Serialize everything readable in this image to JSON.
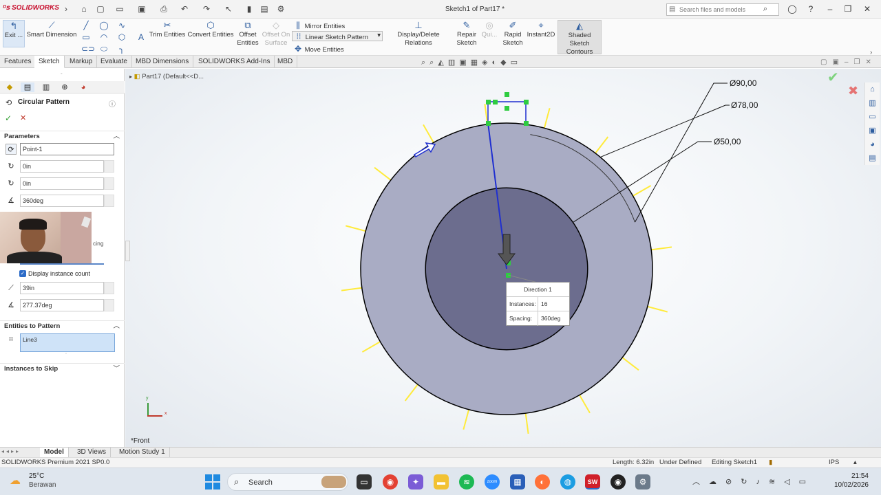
{
  "app": {
    "logo_text": "SOLIDWORKS",
    "doc_title": "Sketch1 of Part17 *",
    "search_placeholder": "Search files and models"
  },
  "ribbon": {
    "exit": "Exit ...",
    "smart_dimension": "Smart Dimension",
    "trim_entities": "Trim Entities",
    "convert_entities": "Convert Entities",
    "offset_entities_l1": "Offset",
    "offset_entities_l2": "Entities",
    "offset_surface_l1": "Offset On",
    "offset_surface_l2": "Surface",
    "mirror_entities": "Mirror Entities",
    "linear_sketch_pattern": "Linear Sketch Pattern",
    "move_entities": "Move Entities",
    "display_delete_relations": "Display/Delete Relations",
    "repair_sketch_l1": "Repair",
    "repair_sketch_l2": "Sketch",
    "quick_snaps": "Qui...",
    "rapid_sketch_l1": "Rapid",
    "rapid_sketch_l2": "Sketch",
    "instant2d": "Instant2D",
    "shaded_contours_l1": "Shaded Sketch",
    "shaded_contours_l2": "Contours"
  },
  "tabs": [
    "Features",
    "Sketch",
    "Markup",
    "Evaluate",
    "MBD Dimensions",
    "SOLIDWORKS Add-Ins",
    "MBD"
  ],
  "active_tab": "Sketch",
  "tree": {
    "item": "Part17  (Default<<D..."
  },
  "property_manager": {
    "title": "Circular Pattern",
    "parameters_label": "Parameters",
    "center_point": "Point-1",
    "x_value": "0in",
    "y_value": "0in",
    "angle": "360deg",
    "spacing_label_fragment": "cing",
    "display_instance_count": "Display instance count",
    "radius": "39in",
    "arc_angle": "277.37deg",
    "entities_label": "Entities to Pattern",
    "entity": "Line3",
    "skip_label": "Instances to Skip"
  },
  "sketch": {
    "dim_outer": "Ø90,00",
    "dim_mid": "Ø78,00",
    "dim_inner": "Ø50,00",
    "direction_title": "Direction 1",
    "instances_label": "Instances:",
    "instances_value": "16",
    "spacing_label": "Spacing:",
    "spacing_value": "360deg",
    "view_label": "*Front",
    "outer_ratio": 0.9,
    "mid_ratio": 0.78,
    "inner_ratio": 0.5,
    "instance_count": 16
  },
  "bottom_tabs": [
    "Model",
    "3D Views",
    "Motion Study 1"
  ],
  "active_bottom_tab": "Model",
  "status": {
    "product": "SOLIDWORKS Premium 2021 SP0.0",
    "length": "Length: 6.32in",
    "state": "Under Defined",
    "editing": "Editing Sketch1",
    "units": "IPS"
  },
  "taskbar": {
    "temperature": "25°C",
    "weather": "Berawan",
    "search": "Search",
    "time": "21:54",
    "date": "10/02/2026"
  },
  "colors": {
    "outer_fill": "#a9acc4",
    "inner_fill": "#6c6d8e",
    "sketch_line": "#1f2fd0",
    "pattern_preview": "#ffeb3b",
    "relation_green": "#2ecc40"
  }
}
